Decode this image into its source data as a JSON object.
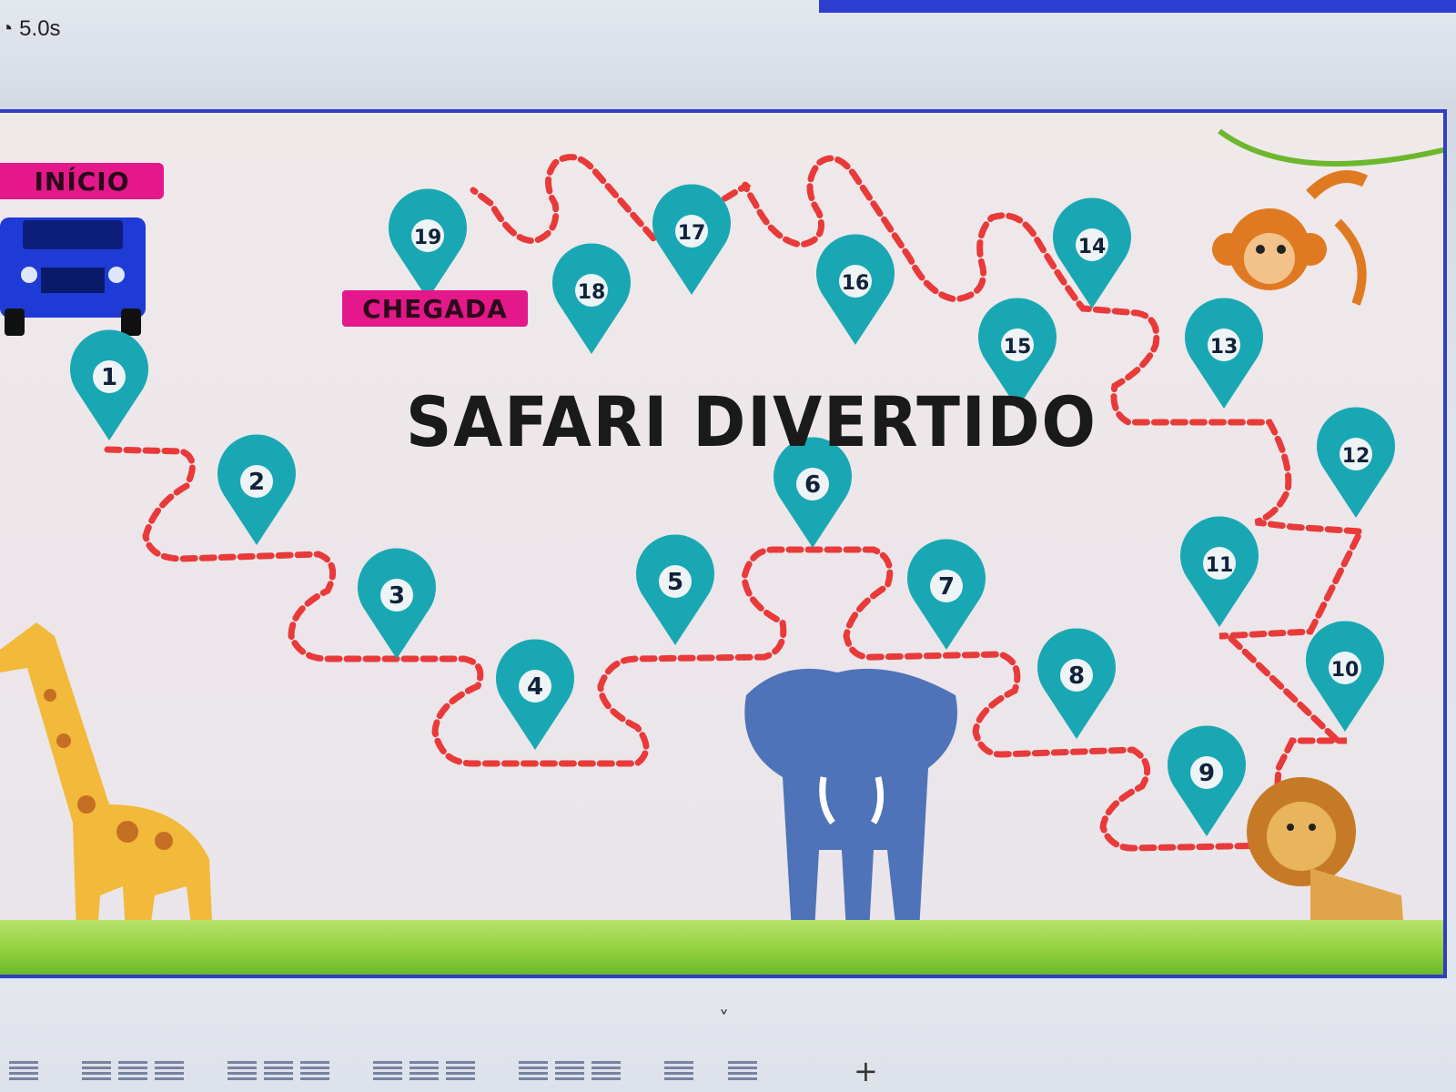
{
  "window": {
    "timer_text": "5.0s"
  },
  "slide": {
    "title": "SAFARI DIVERTIDO",
    "start_label": "INÍCIO",
    "finish_label": "CHEGADA",
    "spaces": [
      "1",
      "2",
      "3",
      "4",
      "5",
      "6",
      "7",
      "8",
      "9",
      "10",
      "11",
      "12",
      "13",
      "14",
      "15",
      "16",
      "17",
      "18",
      "19"
    ]
  },
  "colors": {
    "pin": "#19a8b3",
    "path": "#e93a3a",
    "label_bg": "#e4188a",
    "border": "#2f3fc2"
  },
  "toolbar": {
    "add_label": "+",
    "collapse_label": "˅"
  }
}
